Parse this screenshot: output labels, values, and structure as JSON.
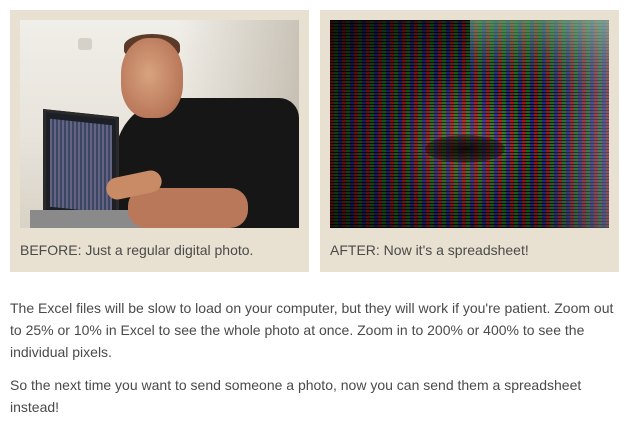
{
  "panels": {
    "before": {
      "caption": "BEFORE: Just a regular digital photo."
    },
    "after": {
      "caption": "AFTER: Now it's a spreadsheet!"
    }
  },
  "body": {
    "paragraphs": [
      "The Excel files will be slow to load on your computer, but they will work if you're patient. Zoom out to 25% or 10% in Excel to see the whole photo at once. Zoom in to 200% or 400% to see the individual pixels.",
      "So the next time you want to send someone a photo, now you can send them a spreadsheet instead!"
    ]
  },
  "colors": {
    "panel_background": "#e8e0d0",
    "text": "#4a4a4a",
    "page_background": "#ffffff"
  }
}
